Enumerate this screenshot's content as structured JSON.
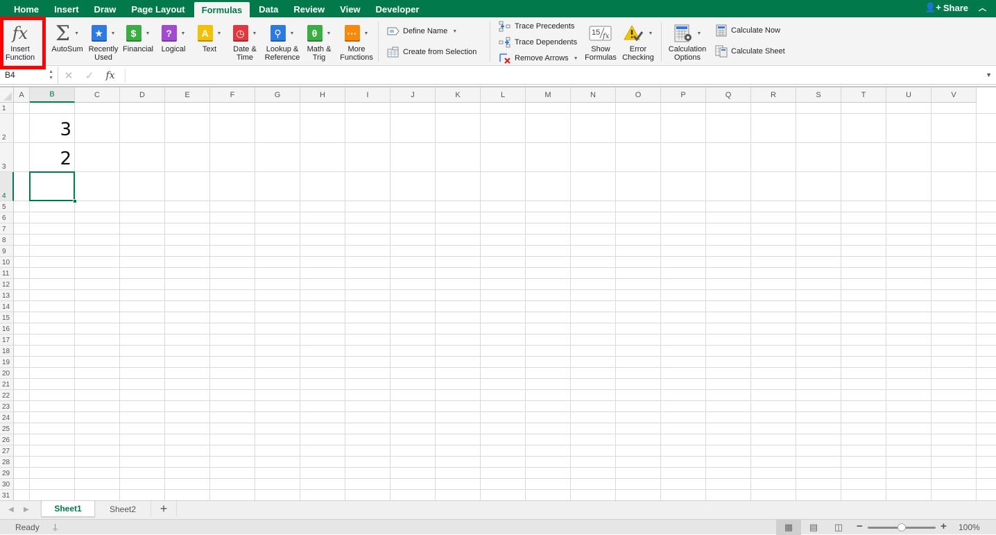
{
  "ribbon_tabs": [
    "Home",
    "Insert",
    "Draw",
    "Page Layout",
    "Formulas",
    "Data",
    "Review",
    "View",
    "Developer"
  ],
  "active_tab": "Formulas",
  "share_label": "Share",
  "ribbon": {
    "insert_function": "Insert\nFunction",
    "library": [
      {
        "label": "AutoSum",
        "icon": "sigma-icon",
        "symbol": "Σ"
      },
      {
        "label": "Recently\nUsed",
        "icon": "star-book-icon",
        "symbol": "★",
        "color": "#2d7be0"
      },
      {
        "label": "Financial",
        "icon": "coins-book-icon",
        "symbol": "$",
        "color": "#3cac45"
      },
      {
        "label": "Logical",
        "icon": "question-book-icon",
        "symbol": "?",
        "color": "#a24bd1"
      },
      {
        "label": "Text",
        "icon": "letter-book-icon",
        "symbol": "A",
        "color": "#f2c200"
      },
      {
        "label": "Date &\nTime",
        "icon": "clock-book-icon",
        "symbol": "◷",
        "color": "#e0383e"
      },
      {
        "label": "Lookup &\nReference",
        "icon": "magnifier-book-icon",
        "symbol": "⚲",
        "color": "#2d7be0"
      },
      {
        "label": "Math &\nTrig",
        "icon": "theta-book-icon",
        "symbol": "θ",
        "color": "#3cac45"
      },
      {
        "label": "More\nFunctions",
        "icon": "ellipsis-book-icon",
        "symbol": "···",
        "color": "#f58a0b"
      }
    ],
    "define_name": "Define Name",
    "create_from_selection": "Create from Selection",
    "trace_precedents": "Trace Precedents",
    "trace_dependents": "Trace Dependents",
    "remove_arrows": "Remove Arrows",
    "show_formulas": "Show\nFormulas",
    "error_checking": "Error\nChecking",
    "calculation_options": "Calculation\nOptions",
    "calculate_now": "Calculate Now",
    "calculate_sheet": "Calculate Sheet",
    "show_formulas_glyph": "15/fx"
  },
  "formula_bar": {
    "name_box": "B4",
    "cancel": "✕",
    "enter": "✓",
    "fx": "fx",
    "value": ""
  },
  "sheet": {
    "columns": [
      "A",
      "B",
      "C",
      "D",
      "E",
      "F",
      "G",
      "H",
      "I",
      "J",
      "K",
      "L",
      "M",
      "N",
      "O",
      "P",
      "Q",
      "R",
      "S",
      "T",
      "U",
      "V"
    ],
    "rows": [
      "1",
      "2",
      "3",
      "4",
      "5",
      "6",
      "7",
      "8",
      "9",
      "10",
      "11",
      "12",
      "13",
      "14",
      "15",
      "16",
      "17",
      "18",
      "19",
      "20",
      "21",
      "22",
      "23",
      "24",
      "25",
      "26",
      "27",
      "28",
      "29",
      "30",
      "31"
    ],
    "selected_cell": "B4",
    "selected_column": "B",
    "selected_row": "4",
    "cells": {
      "B2": "3",
      "B3": "2"
    }
  },
  "sheet_tabs": [
    "Sheet1",
    "Sheet2"
  ],
  "active_sheet": "Sheet1",
  "add_sheet": "+",
  "status": {
    "ready": "Ready",
    "zoom": "100%",
    "zoom_fraction": 0.5
  },
  "highlight_color": "#ff0000"
}
